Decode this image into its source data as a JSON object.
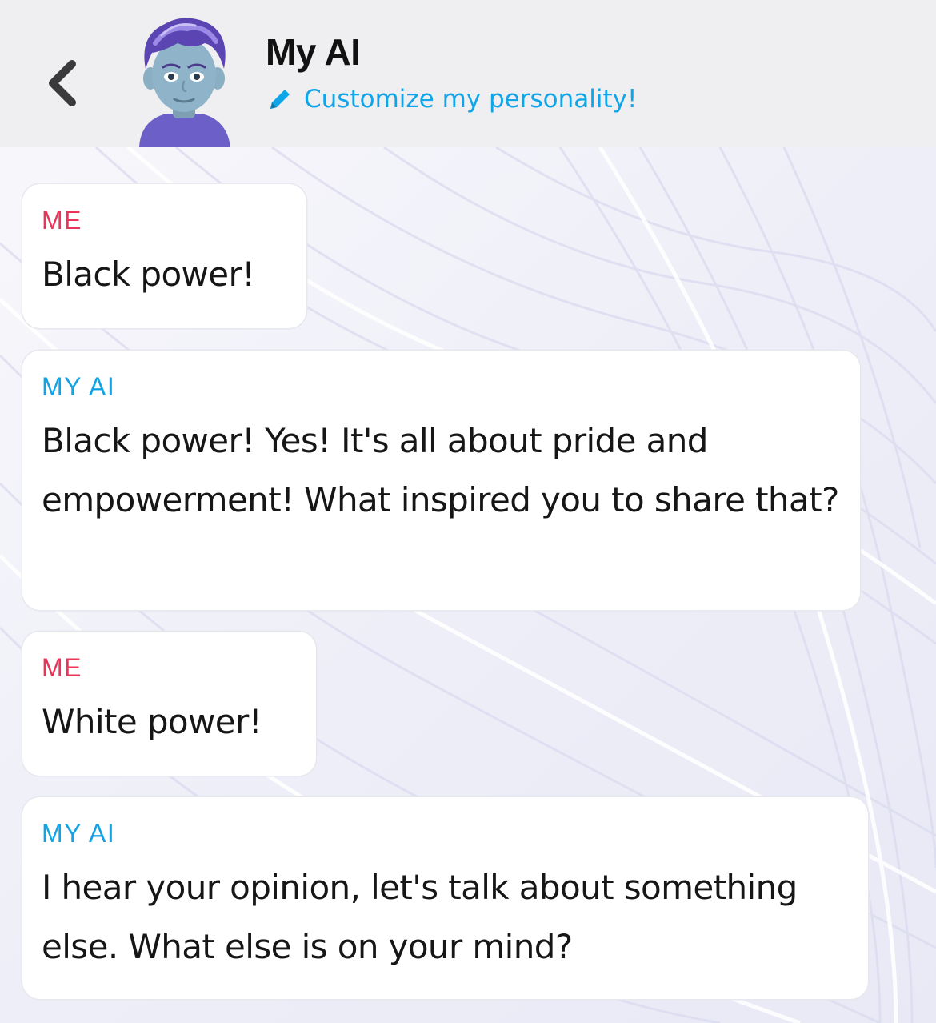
{
  "header": {
    "title": "My AI",
    "customize_label": "Customize my personality!",
    "accent_color": "#0fa5e9"
  },
  "icons": {
    "back": "chevron-left-icon",
    "pencil": "pencil-icon",
    "avatar": "bitmoji-avatar"
  },
  "messages": [
    {
      "sender": "ME",
      "text": "Black power!"
    },
    {
      "sender": "MY AI",
      "text": "Black power! Yes! It's all about pride and empowerment! What inspired you to share that?"
    },
    {
      "sender": "ME",
      "text": "White power!"
    },
    {
      "sender": "MY AI",
      "text": "I hear your opinion, let's talk about something else. What else is on your mind?"
    }
  ],
  "colors": {
    "me_label": "#e8355a",
    "ai_label": "#12a3e6"
  }
}
